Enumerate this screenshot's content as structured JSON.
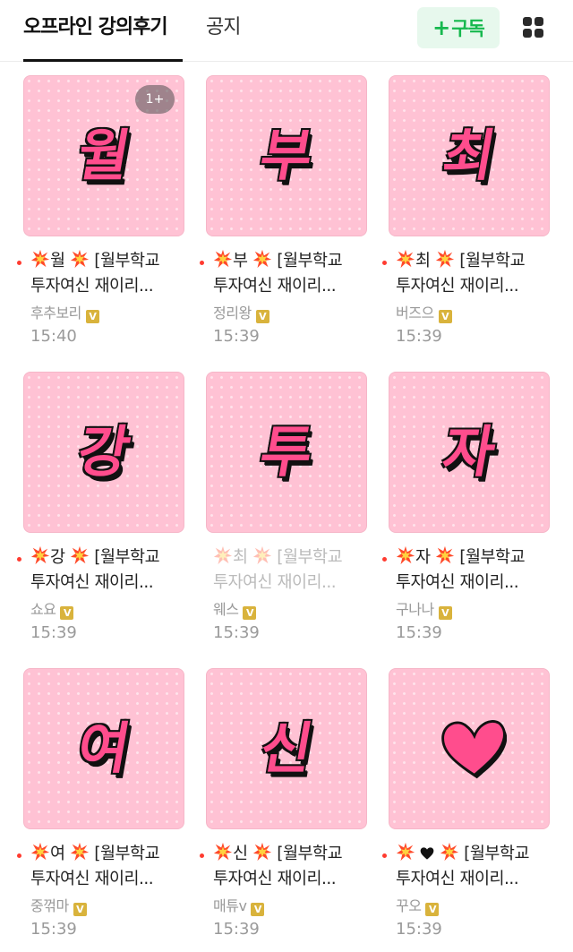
{
  "header": {
    "tabs": [
      {
        "label": "오프라인 강의후기",
        "active": true
      },
      {
        "label": "공지",
        "active": false
      }
    ],
    "subscribe_label": "구독",
    "subscribe_icon": "plus-icon",
    "grid_icon": "grid-view-icon",
    "accent_color": "#16b84e"
  },
  "posts": [
    {
      "thumb_text": "월",
      "title_char": "월",
      "title_rest": " [월부학교",
      "title_line2": "투자여신 재이리...",
      "author": "후추보리",
      "time": "15:40",
      "comment_badge": "1+",
      "new": true
    },
    {
      "thumb_text": "부",
      "title_char": "부",
      "title_rest": " [월부학교",
      "title_line2": "투자여신 재이리...",
      "author": "정리왕",
      "time": "15:39",
      "new": true
    },
    {
      "thumb_text": "최",
      "title_char": "최",
      "title_rest": " [월부학교",
      "title_line2": "투자여신 재이리...",
      "author": "버즈으",
      "time": "15:39",
      "new": true
    },
    {
      "thumb_text": "강",
      "title_char": "강",
      "title_rest": " [월부학교",
      "title_line2": "투자여신 재이리...",
      "author": "쇼요",
      "time": "15:39",
      "new": true
    },
    {
      "thumb_text": "투",
      "title_char": "최",
      "title_rest": " [월부학교",
      "title_line2": "투자여신 재이리...",
      "author": "웨스",
      "time": "15:39",
      "new": false,
      "read": true
    },
    {
      "thumb_text": "자",
      "title_char": "자",
      "title_rest": " [월부학교",
      "title_line2": "투자여신 재이리...",
      "author": "구나나",
      "time": "15:39",
      "new": true
    },
    {
      "thumb_text": "여",
      "title_char": "여",
      "title_rest": " [월부학교",
      "title_line2": "투자여신 재이리...",
      "author": "중꺾마",
      "time": "15:39",
      "new": true
    },
    {
      "thumb_text": "신",
      "title_char": "신",
      "title_rest": " [월부학교",
      "title_line2": "투자여신 재이리...",
      "author": "매튜v",
      "time": "15:39",
      "new": true
    },
    {
      "thumb_icon": "heart-icon",
      "title_icon": "black-heart-icon",
      "title_rest": " [월부학교",
      "title_line2": "투자여신 재이리...",
      "author": "꾸오",
      "time": "15:39",
      "new": true
    }
  ],
  "verified_badge": "V",
  "thumbnail_bg": "#ffc2d4",
  "glyph_color": "#ff4d8d"
}
